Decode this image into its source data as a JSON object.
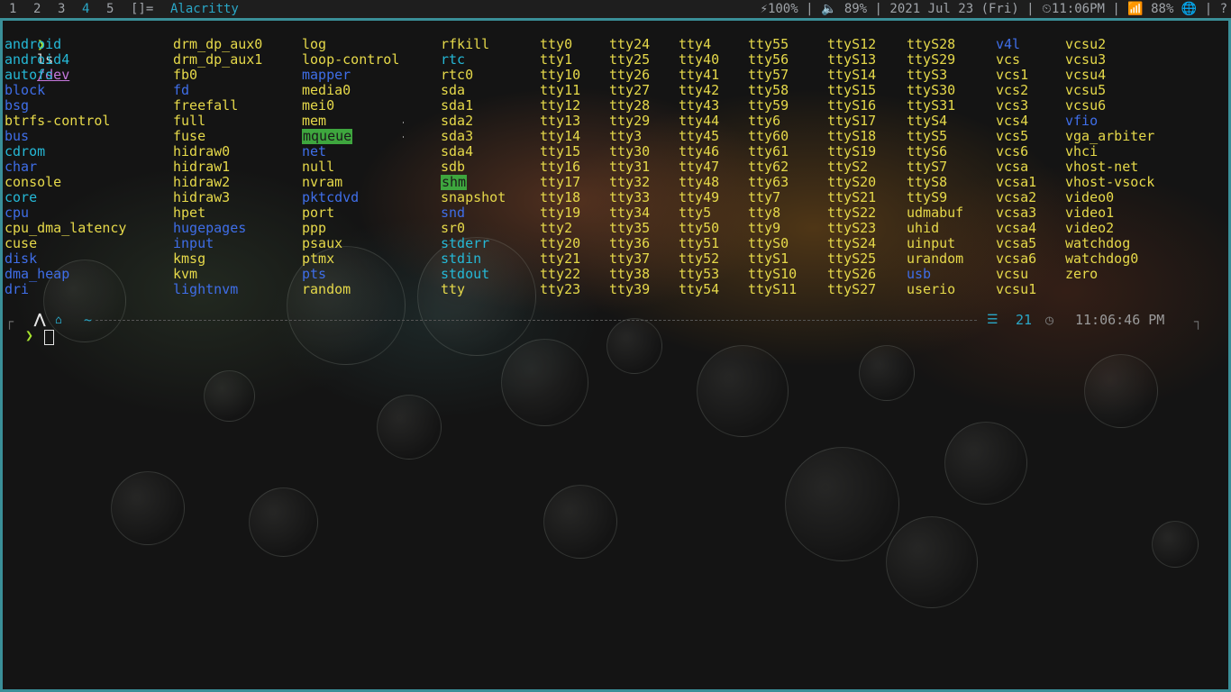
{
  "bar": {
    "workspaces": [
      "1",
      "2",
      "3",
      "4",
      "5"
    ],
    "active_workspace": "4",
    "layout": "[]=",
    "window_title": "Alacritty",
    "status": [
      "⚡100%",
      " | ",
      "🔈 89%",
      " | ",
      "2021 Jul 23 (Fri)",
      " | ",
      "⏲11:06PM",
      " | ",
      "📶 88%",
      " ",
      "🌐",
      " | ",
      "?"
    ]
  },
  "terminal": {
    "prompt_symbol": "❯",
    "command": "ls",
    "argument": "/dev",
    "columns": [
      [
        "android",
        "android4",
        "autofs",
        "block",
        "bsg",
        "btrfs-control",
        "bus",
        "cdrom",
        "char",
        "console",
        "core",
        "cpu",
        "cpu_dma_latency",
        "cuse",
        "disk",
        "dma_heap",
        "dri"
      ],
      [
        "drm_dp_aux0",
        "drm_dp_aux1",
        "fb0",
        "fd",
        "freefall",
        "full",
        "fuse",
        "hidraw0",
        "hidraw1",
        "hidraw2",
        "hidraw3",
        "hpet",
        "hugepages",
        "input",
        "kmsg",
        "kvm",
        "lightnvm"
      ],
      [
        "log",
        "loop-control",
        "mapper",
        "media0",
        "mei0",
        "mem",
        "mqueue",
        "net",
        "null",
        "nvram",
        "pktcdvd",
        "port",
        "ppp",
        "psaux",
        "ptmx",
        "pts",
        "random"
      ],
      [
        "rfkill",
        "rtc",
        "rtc0",
        "sda",
        "sda1",
        "sda2",
        "sda3",
        "sda4",
        "sdb",
        "shm",
        "snapshot",
        "snd",
        "sr0",
        "stderr",
        "stdin",
        "stdout",
        "tty"
      ],
      [
        "tty0",
        "tty1",
        "tty10",
        "tty11",
        "tty12",
        "tty13",
        "tty14",
        "tty15",
        "tty16",
        "tty17",
        "tty18",
        "tty19",
        "tty2",
        "tty20",
        "tty21",
        "tty22",
        "tty23"
      ],
      [
        "tty24",
        "tty25",
        "tty26",
        "tty27",
        "tty28",
        "tty29",
        "tty3",
        "tty30",
        "tty31",
        "tty32",
        "tty33",
        "tty34",
        "tty35",
        "tty36",
        "tty37",
        "tty38",
        "tty39"
      ],
      [
        "tty4",
        "tty40",
        "tty41",
        "tty42",
        "tty43",
        "tty44",
        "tty45",
        "tty46",
        "tty47",
        "tty48",
        "tty49",
        "tty5",
        "tty50",
        "tty51",
        "tty52",
        "tty53",
        "tty54"
      ],
      [
        "tty55",
        "tty56",
        "tty57",
        "tty58",
        "tty59",
        "tty6",
        "tty60",
        "tty61",
        "tty62",
        "tty63",
        "tty7",
        "tty8",
        "tty9",
        "ttyS0",
        "ttyS1",
        "ttyS10",
        "ttyS11"
      ],
      [
        "ttyS12",
        "ttyS13",
        "ttyS14",
        "ttyS15",
        "ttyS16",
        "ttyS17",
        "ttyS18",
        "ttyS19",
        "ttyS2",
        "ttyS20",
        "ttyS21",
        "ttyS22",
        "ttyS23",
        "ttyS24",
        "ttyS25",
        "ttyS26",
        "ttyS27"
      ],
      [
        "ttyS28",
        "ttyS29",
        "ttyS3",
        "ttyS30",
        "ttyS31",
        "ttyS4",
        "ttyS5",
        "ttyS6",
        "ttyS7",
        "ttyS8",
        "ttyS9",
        "udmabuf",
        "uhid",
        "uinput",
        "urandom",
        "usb",
        "userio"
      ],
      [
        "v4l",
        "vcs",
        "vcs1",
        "vcs2",
        "vcs3",
        "vcs4",
        "vcs5",
        "vcs6",
        "vcsa",
        "vcsa1",
        "vcsa2",
        "vcsa3",
        "vcsa4",
        "vcsa5",
        "vcsa6",
        "vcsu",
        "vcsu1"
      ],
      [
        "vcsu2",
        "vcsu3",
        "vcsu4",
        "vcsu5",
        "vcsu6",
        "vfio",
        "vga_arbiter",
        "vhci",
        "vhost-net",
        "vhost-vsock",
        "video0",
        "video1",
        "video2",
        "watchdog",
        "watchdog0",
        "zero"
      ]
    ],
    "directories": [
      "block",
      "bsg",
      "bus",
      "char",
      "cpu",
      "disk",
      "dma_heap",
      "dri",
      "fd",
      "hugepages",
      "input",
      "lightnvm",
      "mapper",
      "net",
      "pktcdvd",
      "pts",
      "snd",
      "usb",
      "v4l",
      "vfio"
    ],
    "symlinks": [
      "android",
      "android4",
      "autofs",
      "cdrom",
      "core",
      "fd",
      "rtc",
      "stderr",
      "stdin",
      "stdout"
    ],
    "highlighted": [
      "mqueue",
      "shm"
    ],
    "colors": {
      "directory": "#3f6ee8",
      "symlink": "#25b8d6",
      "device": "#e6d94a",
      "highlight_bg": "#3ea63e",
      "prompt": "#a6e22e",
      "border": "#3a8f98"
    }
  },
  "prompt2": {
    "arch_icon": "arch-icon",
    "home_icon": "home-icon",
    "path": "~",
    "jobs_count": "21",
    "time": "11:06:46 PM",
    "prompt_symbol": "❯"
  }
}
